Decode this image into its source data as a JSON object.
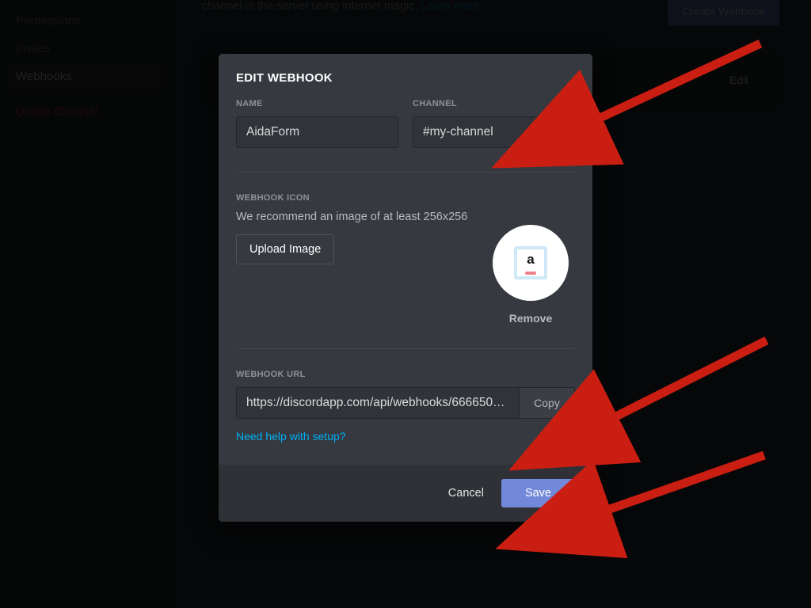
{
  "sidebar": {
    "items": [
      {
        "label": "Permissions"
      },
      {
        "label": "Invites"
      },
      {
        "label": "Webhooks",
        "active": true
      }
    ],
    "delete_label": "Delete Channel"
  },
  "main": {
    "desc_line": "channel in the server using internet magic.",
    "learn_more": "Learn more",
    "create_label": "Create Webhook",
    "edit_label": "Edit"
  },
  "modal": {
    "title": "EDIT WEBHOOK",
    "name_label": "NAME",
    "name_value": "AidaForm",
    "channel_label": "CHANNEL",
    "channel_value": "#my-channel",
    "icon_label": "WEBHOOK ICON",
    "icon_rec": "We recommend an image of at least 256x256",
    "upload_label": "Upload Image",
    "remove_label": "Remove",
    "url_label": "WEBHOOK URL",
    "url_value": "https://discordapp.com/api/webhooks/666650…",
    "copy_label": "Copy",
    "help_label": "Need help with setup?",
    "cancel_label": "Cancel",
    "save_label": "Save",
    "avatar_letter": "a"
  }
}
